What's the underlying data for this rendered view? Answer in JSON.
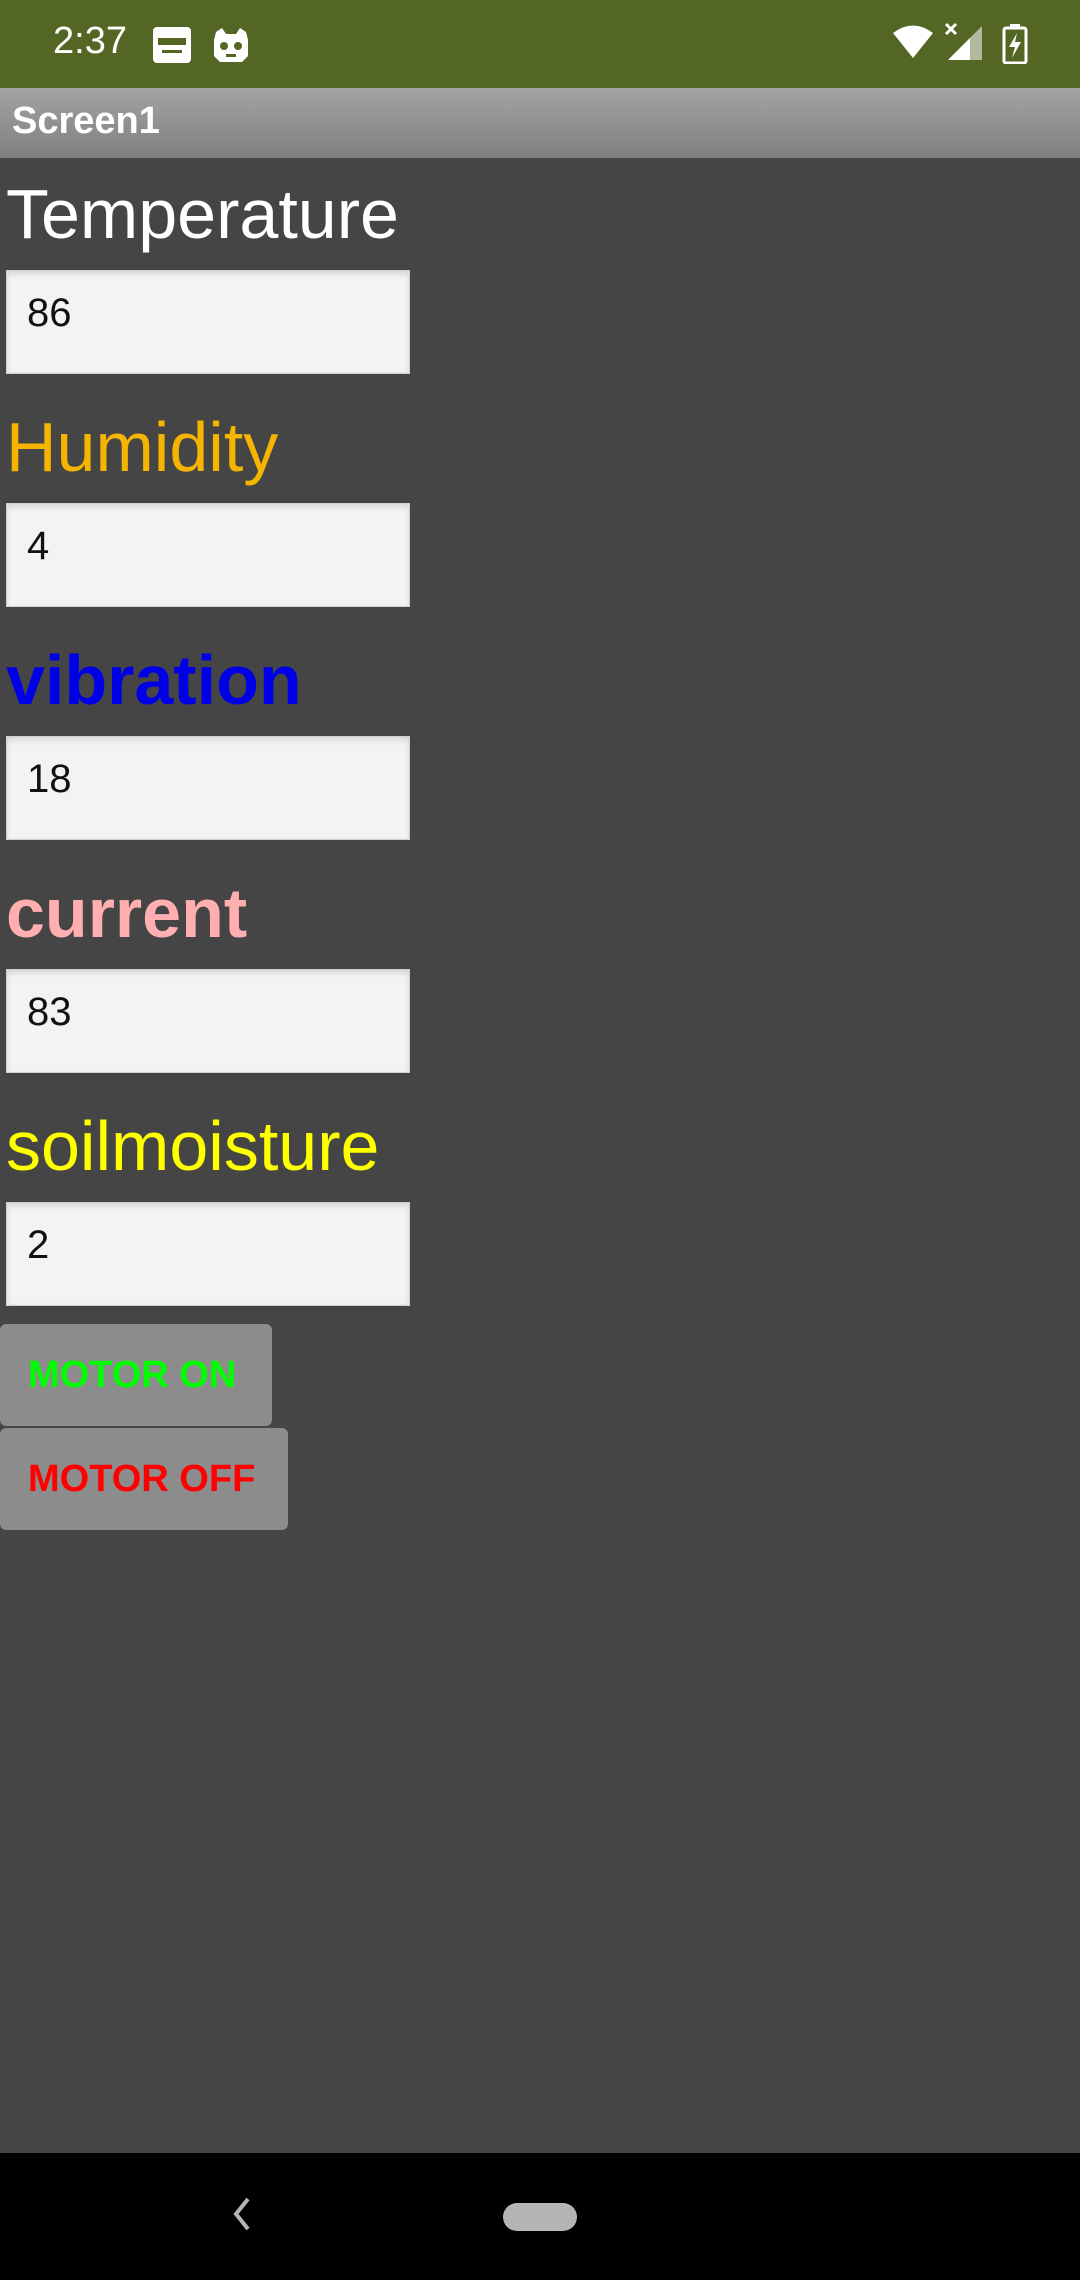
{
  "status_bar": {
    "time": "2:37",
    "icons": [
      "paytm-icon",
      "game-controller-icon",
      "wifi-icon",
      "signal-icon",
      "battery-charging-icon"
    ]
  },
  "app": {
    "title": "Screen1"
  },
  "fields": [
    {
      "label": "Temperature",
      "value": "86",
      "label_color": "#ffffff"
    },
    {
      "label": "Humidity",
      "value": "4",
      "label_color": "#f4b400"
    },
    {
      "label": "vibration",
      "value": "18",
      "label_color": "#0000e6"
    },
    {
      "label": "current",
      "value": "83",
      "label_color": "#ffafaf"
    },
    {
      "label": "soilmoisture",
      "value": "2",
      "label_color": "#ffff00"
    }
  ],
  "buttons": {
    "motor_on": {
      "label": "MOTOR ON",
      "color": "#00ff00"
    },
    "motor_off": {
      "label": "MOTOR OFF",
      "color": "#ff0000"
    }
  },
  "colors": {
    "status_bar": "#536624",
    "background": "#454545",
    "title_bar": "#8f8f8f"
  }
}
